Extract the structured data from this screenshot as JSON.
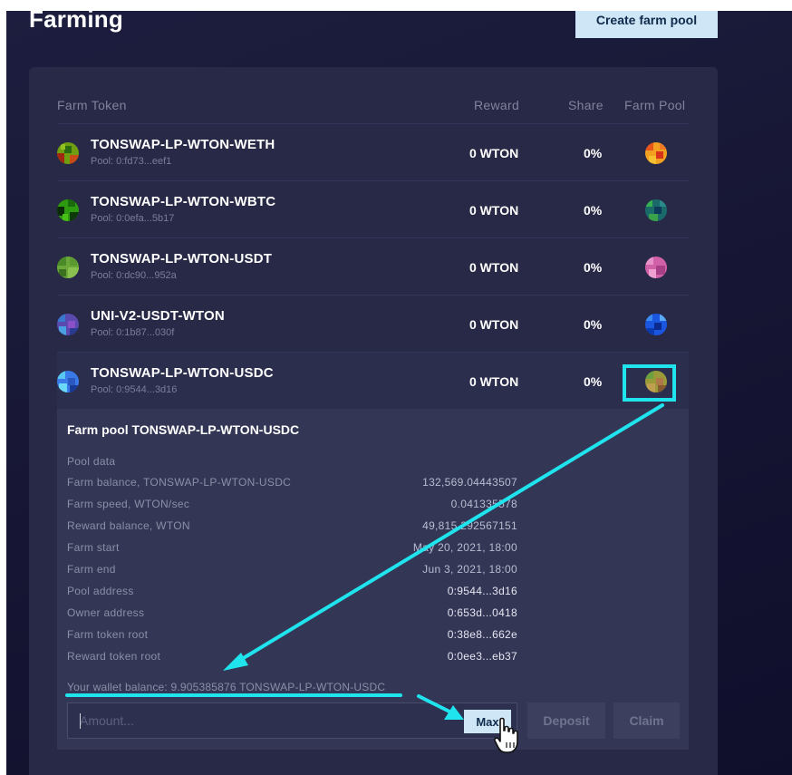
{
  "page": {
    "title": "Farming",
    "create_button": "Create farm pool"
  },
  "table": {
    "headers": {
      "farm_token": "Farm Token",
      "reward": "Reward",
      "share": "Share",
      "farm_pool": "Farm Pool"
    },
    "rows": [
      {
        "name": "TONSWAP-LP-WTON-WETH",
        "pool": "Pool: 0:fd73...eef1",
        "reward": "0 WTON",
        "share": "0%"
      },
      {
        "name": "TONSWAP-LP-WTON-WBTC",
        "pool": "Pool: 0:0efa...5b17",
        "reward": "0 WTON",
        "share": "0%"
      },
      {
        "name": "TONSWAP-LP-WTON-USDT",
        "pool": "Pool: 0:dc90...952a",
        "reward": "0 WTON",
        "share": "0%"
      },
      {
        "name": "UNI-V2-USDT-WTON",
        "pool": "Pool: 0:1b87...030f",
        "reward": "0 WTON",
        "share": "0%"
      },
      {
        "name": "TONSWAP-LP-WTON-USDC",
        "pool": "Pool: 0:9544...3d16",
        "reward": "0 WTON",
        "share": "0%"
      }
    ]
  },
  "details": {
    "title": "Farm pool TONSWAP-LP-WTON-USDC",
    "section": "Pool data",
    "rows": [
      {
        "label": "Farm balance, TONSWAP-LP-WTON-USDC",
        "value": "132,569.04443507"
      },
      {
        "label": "Farm speed, WTON/sec",
        "value": "0.041335578"
      },
      {
        "label": "Reward balance, WTON",
        "value": "49,815.292567151"
      },
      {
        "label": "Farm start",
        "value": "May 20, 2021, 18:00"
      },
      {
        "label": "Farm end",
        "value": "Jun 3, 2021, 18:00"
      },
      {
        "label": "Pool address",
        "value": "0:9544...3d16"
      },
      {
        "label": "Owner address",
        "value": "0:653d...0418"
      },
      {
        "label": "Farm token root",
        "value": "0:38e8...662e"
      },
      {
        "label": "Reward token root",
        "value": "0:0ee3...eb37"
      }
    ],
    "wallet_balance": "Your wallet balance: 9.905385876 TONSWAP-LP-WTON-USDC",
    "amount": {
      "placeholder": "Amount...",
      "value": ""
    },
    "buttons": {
      "max": "Max",
      "deposit": "Deposit",
      "claim": "Claim"
    }
  },
  "colors": {
    "background": "#171735",
    "panel": "#282946",
    "details_panel": "#343656",
    "accent_button": "#cfe6f7",
    "annotation": "#1fe4ee"
  },
  "icons": {
    "row_icons": [
      "identicon-green-red",
      "identicon-green-black",
      "identicon-green-olive",
      "identicon-blue-purple",
      "identicon-blue-cyan"
    ],
    "pool_icons": [
      "identicon-orange-red",
      "identicon-teal-green",
      "identicon-pink-purple",
      "identicon-blue-navy",
      "identicon-green-olive-red"
    ],
    "cursor": "hand-pointer-icon",
    "annotation_arrows": "arrow-icon"
  }
}
